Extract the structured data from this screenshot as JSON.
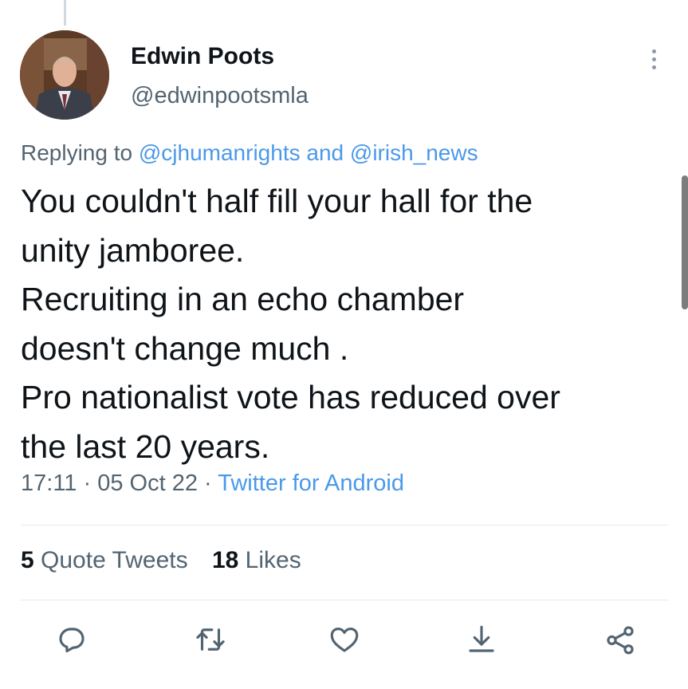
{
  "tweet": {
    "author": {
      "name": "Edwin Poots",
      "handle": "@edwinpootsmla"
    },
    "reply": {
      "prefix": "Replying to",
      "mention1": "@cjhumanrights",
      "joiner": "and",
      "mention2": "@irish_news"
    },
    "text_lines": [
      "You couldn't half fill your hall for the",
      "unity jamboree.",
      "Recruiting in an echo chamber",
      "doesn't change much .",
      "Pro nationalist vote has reduced over",
      "the last 20 years."
    ],
    "meta": {
      "time": "17:11",
      "sep": "·",
      "date": "05 Oct 22",
      "source": "Twitter for Android"
    },
    "stats": {
      "quote_count": "5",
      "quote_label": "Quote Tweets",
      "likes_count": "18",
      "likes_label": "Likes"
    }
  },
  "icons": {
    "reply": "reply-icon",
    "retweet": "retweet-icon",
    "like": "heart-icon",
    "download": "download-icon",
    "share": "share-icon",
    "more": "more-vertical-icon"
  },
  "colors": {
    "link": "#4a99e9",
    "text_primary": "#0f1419",
    "text_secondary": "#536471",
    "divider": "#e5e9eb"
  }
}
